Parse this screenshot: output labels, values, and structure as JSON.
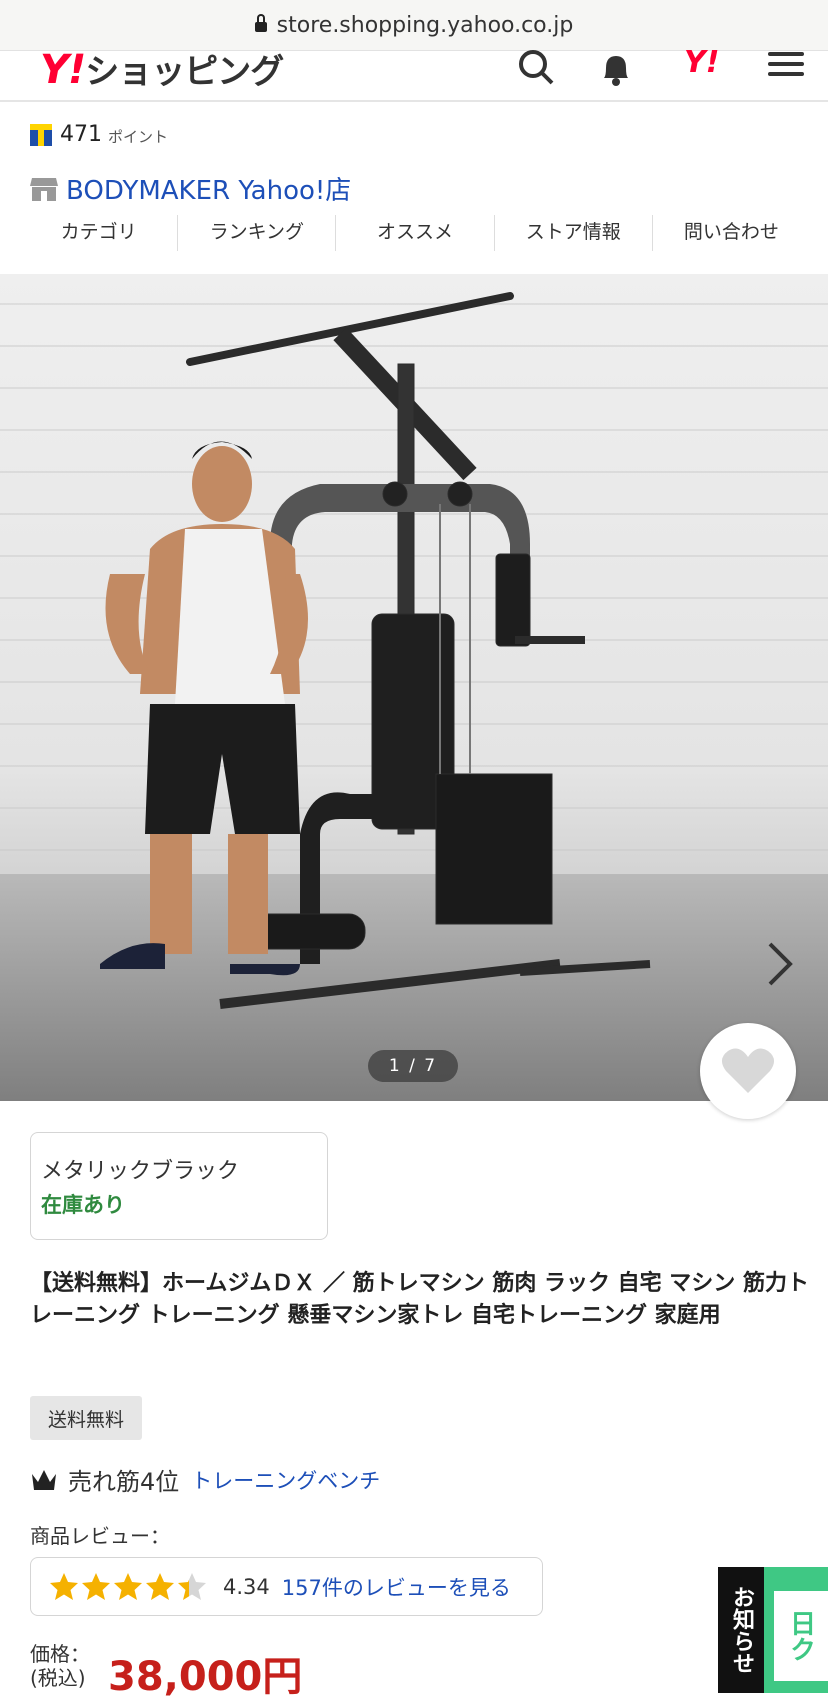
{
  "browser": {
    "url": "store.shopping.yahoo.co.jp"
  },
  "header": {
    "logo_y": "Y!",
    "logo_text": "ショッピング"
  },
  "points": {
    "value": "471",
    "unit": "ポイント"
  },
  "store": {
    "name": "BODYMAKER Yahoo!店"
  },
  "store_nav": [
    "カテゴリ",
    "ランキング",
    "オススメ",
    "ストア情報",
    "問い合わせ"
  ],
  "gallery": {
    "counter": "1 / 7"
  },
  "variant": {
    "name": "メタリックブラック",
    "stock": "在庫あり"
  },
  "product": {
    "title": "【送料無料】ホームジムＤＸ ／ 筋トレマシン 筋肉 ラック 自宅 マシン 筋力トレーニング トレーニング 懸垂マシン家トレ 自宅トレーニング 家庭用",
    "badge": "送料無料"
  },
  "ranking": {
    "text": "売れ筋4位",
    "category": "トレーニングベンチ"
  },
  "review": {
    "label": "商品レビュー：",
    "score": "4.34",
    "rating": 4.34,
    "link": "157件のレビューを見る"
  },
  "price": {
    "label_1": "価格：",
    "label_2": "(税込)",
    "value": "38,000円"
  },
  "notice": {
    "tab_text": "お知らせ",
    "banner_text": "日ク"
  },
  "colors": {
    "link": "#1d4fb8",
    "price": "#c6201b",
    "stock": "#2f8a3f",
    "yahoo_red": "#ff0033"
  }
}
